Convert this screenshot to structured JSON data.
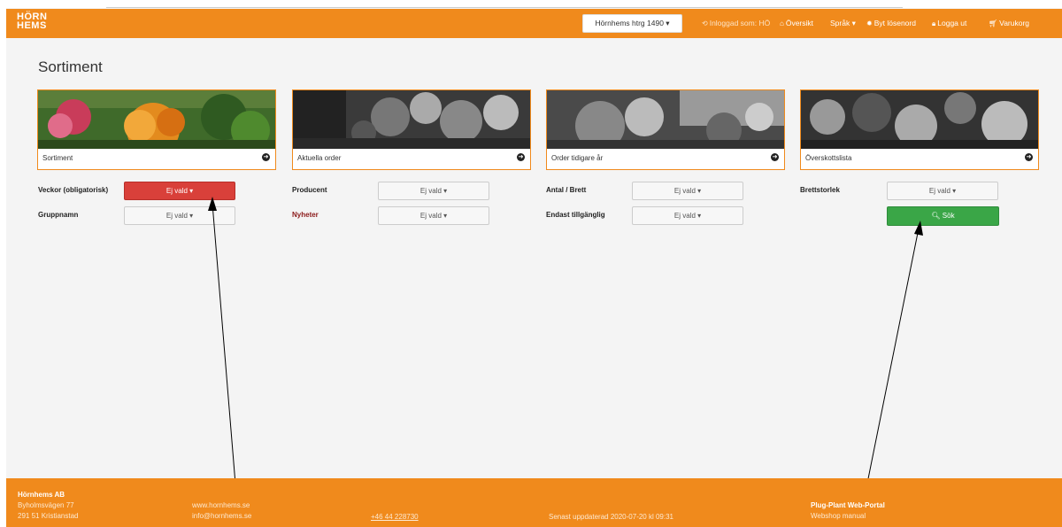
{
  "header": {
    "logo_line1": "HÖRN",
    "logo_line2": "HEMS",
    "site_select": "Hörnhems htrg 1490 ▾",
    "logged_in": "Inloggad som: HÖ",
    "overview": "Översikt",
    "language": "Språk ▾",
    "change_password": "Byt lösenord",
    "logout": "Logga ut",
    "cart": "Varukorg"
  },
  "page": {
    "title": "Sortiment"
  },
  "cards": [
    {
      "label": "Sortiment"
    },
    {
      "label": "Aktuella order"
    },
    {
      "label": "Order tidigare år"
    },
    {
      "label": "Överskottslista"
    }
  ],
  "filters": {
    "weeks_label": "Veckor (obligatorisk)",
    "weeks_value": "Ej vald ▾",
    "group_label": "Gruppnamn",
    "group_value": "Ej vald ▾",
    "producer_label": "Producent",
    "producer_value": "Ej vald ▾",
    "news_label": "Nyheter",
    "news_value": "Ej vald ▾",
    "count_label": "Antal / Brett",
    "count_value": "Ej vald ▾",
    "available_label": "Endast tillgänglig",
    "available_value": "Ej vald ▾",
    "tray_label": "Brettstorlek",
    "tray_value": "Ej vald ▾",
    "search_label": "Sök"
  },
  "footer": {
    "company": "Hörnhems AB",
    "street": "Byholmsvägen 77",
    "city": "291 51 Kristianstad",
    "web": "www.hornhems.se",
    "email": "info@hornhems.se",
    "phone": "+46 44 228730",
    "updated": "Senast uppdaterad 2020-07-20 kl 09:31",
    "portal": "Plug-Plant Web-Portal",
    "manual": "Webshop manual"
  },
  "colors": {
    "brand": "#f08a1c",
    "danger": "#d9403a",
    "success": "#3aa647"
  }
}
